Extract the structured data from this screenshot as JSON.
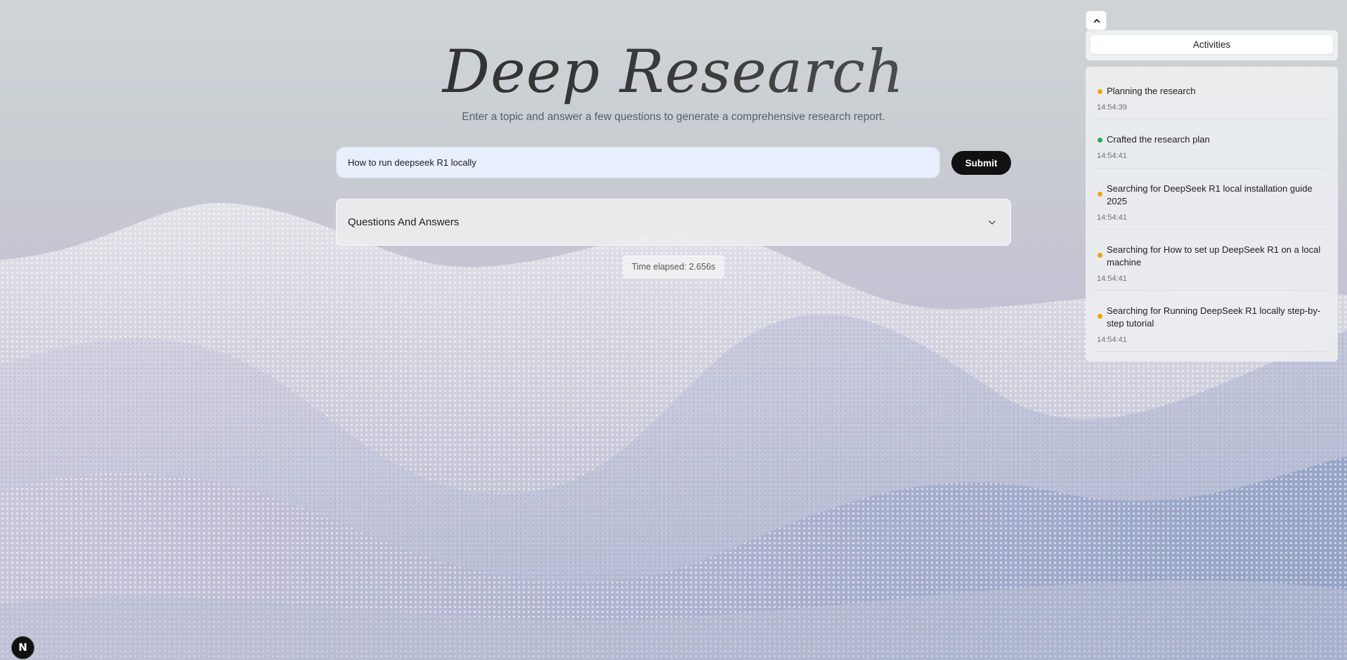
{
  "hero": {
    "title": "Deep Research",
    "subtitle": "Enter a topic and answer a few questions to generate a comprehensive research report."
  },
  "search": {
    "value": "How to run deepseek R1 locally",
    "submit_label": "Submit"
  },
  "qa": {
    "title": "Questions And Answers",
    "icon": "chevron-down-icon"
  },
  "timer": {
    "label": "Time elapsed: 2.656s"
  },
  "activities": {
    "collapse_icon": "chevron-up-icon",
    "tab_label": "Activities",
    "items": [
      {
        "text": "Planning the research",
        "time": "14:54:39",
        "status": "in-progress"
      },
      {
        "text": "Crafted the research plan",
        "time": "14:54:41",
        "status": "complete"
      },
      {
        "text": "Searching for DeepSeek R1 local installation guide 2025",
        "time": "14:54:41",
        "status": "in-progress"
      },
      {
        "text": "Searching for How to set up DeepSeek R1 on a local machine",
        "time": "14:54:41",
        "status": "in-progress"
      },
      {
        "text": "Searching for Running DeepSeek R1 locally step-by-step tutorial",
        "time": "14:54:41",
        "status": "in-progress"
      }
    ]
  },
  "colors": {
    "in-progress": "#e8a70d",
    "complete": "#25b04f",
    "submit_bg": "#111111",
    "input_bg": "#e8effd"
  },
  "dev_badge": {
    "label": "N",
    "icon": "nextjs-icon"
  }
}
